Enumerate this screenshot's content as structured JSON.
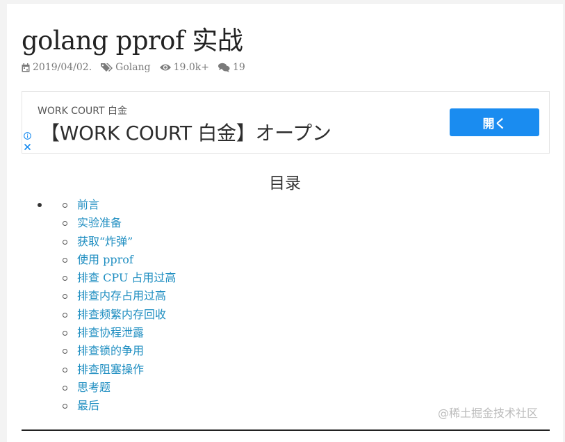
{
  "article": {
    "title": "golang pprof 实战",
    "meta": {
      "date": "2019/04/02.",
      "category": "Golang",
      "views": "19.0k+",
      "comments": "19"
    }
  },
  "ad": {
    "sub": "WORK COURT 白金",
    "headline": "【WORK COURT 白金】オープン",
    "button": "開く",
    "accent": "#1a8cf0"
  },
  "toc": {
    "title": "目录",
    "items": [
      "前言",
      "实验准备",
      "获取“炸弹”",
      "使用 pprof",
      "排查 CPU 占用过高",
      "排查内存占用过高",
      "排查频繁内存回收",
      "排查协程泄露",
      "排查锁的争用",
      "排查阻塞操作",
      "思考题",
      "最后"
    ],
    "link_color": "#1f8ec1"
  },
  "watermark": "@稀土掘金技术社区",
  "icons": [
    "calendar-icon",
    "tags-icon",
    "eye-icon",
    "comments-icon",
    "adchoices-info-icon",
    "ad-close-icon"
  ]
}
